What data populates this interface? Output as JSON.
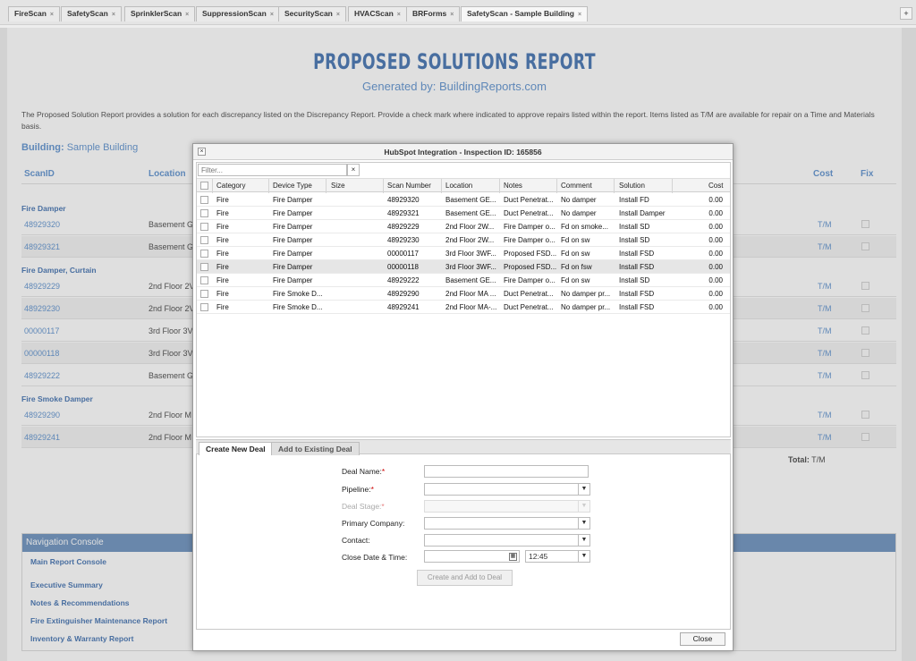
{
  "tabs": [
    {
      "label": "FireScan"
    },
    {
      "label": "SafetyScan"
    },
    {
      "label": "SprinklerScan"
    },
    {
      "label": "SuppressionScan"
    },
    {
      "label": "SecurityScan"
    },
    {
      "label": "HVACScan"
    },
    {
      "label": "BRForms"
    },
    {
      "label": "SafetyScan - Sample Building",
      "active": true
    }
  ],
  "tab_close_glyph": "×",
  "tab_add_label": "+",
  "report": {
    "title": "PROPOSED SOLUTIONS REPORT",
    "subtitle": "Generated by: BuildingReports.com",
    "intro": "The Proposed Solution Report provides a solution for each discrepancy listed on the Discrepancy Report. Provide a check mark where indicated to approve repairs listed within the report. Items listed as T/M are available for repair on a Time and Materials basis.",
    "building_label": "Building:",
    "building_name": "Sample Building",
    "columns": {
      "scan_id": "ScanID",
      "location": "Location",
      "cost": "Cost",
      "fix": "Fix"
    },
    "groups": [
      {
        "name": "Fire Damper",
        "rows": [
          {
            "scan_id": "48929320",
            "location": "Basement G",
            "cost": "T/M"
          },
          {
            "scan_id": "48929321",
            "location": "Basement G",
            "cost": "T/M"
          }
        ]
      },
      {
        "name": "Fire Damper, Curtain",
        "rows": [
          {
            "scan_id": "48929229",
            "location": "2nd Floor 2V",
            "cost": "T/M"
          },
          {
            "scan_id": "48929230",
            "location": "2nd Floor 2V",
            "cost": "T/M"
          },
          {
            "scan_id": "00000117",
            "location": "3rd Floor 3V",
            "cost": "T/M"
          },
          {
            "scan_id": "00000118",
            "location": "3rd Floor 3V",
            "cost": "T/M"
          },
          {
            "scan_id": "48929222",
            "location": "Basement G",
            "cost": "T/M"
          }
        ]
      },
      {
        "name": "Fire Smoke Damper",
        "rows": [
          {
            "scan_id": "48929290",
            "location": "2nd Floor M",
            "cost": "T/M"
          },
          {
            "scan_id": "48929241",
            "location": "2nd Floor M",
            "cost": "T/M"
          }
        ]
      }
    ],
    "total_label": "Total:",
    "total_value": "T/M"
  },
  "nav_console": {
    "title": "Navigation Console",
    "links": [
      "Main Report Console",
      "Executive Summary",
      "Notes & Recommendations",
      "Fire Extinguisher Maintenance Report",
      "Inventory & Warranty Report"
    ]
  },
  "dialog": {
    "title": "HubSpot Integration - Inspection ID: 165856",
    "close_x": "×",
    "filter_placeholder": "Filter...",
    "filter_clear": "×",
    "columns": [
      "Category",
      "Device Type",
      "Size",
      "Scan Number",
      "Location",
      "Notes",
      "Comment",
      "Solution",
      "Cost"
    ],
    "rows": [
      {
        "category": "Fire",
        "device_type": "Fire Damper",
        "size": "",
        "scan_number": "48929320",
        "location": "Basement GE...",
        "notes": "Duct Penetrat...",
        "comment": "No damper",
        "solution": "Install FD",
        "cost": "0.00"
      },
      {
        "category": "Fire",
        "device_type": "Fire Damper",
        "size": "",
        "scan_number": "48929321",
        "location": "Basement GE...",
        "notes": "Duct Penetrat...",
        "comment": "No damper",
        "solution": "Install Damper",
        "cost": "0.00"
      },
      {
        "category": "Fire",
        "device_type": "Fire Damper",
        "size": "",
        "scan_number": "48929229",
        "location": "2nd Floor 2W...",
        "notes": "Fire Damper o...",
        "comment": "Fd on smoke...",
        "solution": "Install SD",
        "cost": "0.00"
      },
      {
        "category": "Fire",
        "device_type": "Fire Damper",
        "size": "",
        "scan_number": "48929230",
        "location": "2nd Floor 2W...",
        "notes": "Fire Damper o...",
        "comment": "Fd on sw",
        "solution": "Install SD",
        "cost": "0.00"
      },
      {
        "category": "Fire",
        "device_type": "Fire Damper",
        "size": "",
        "scan_number": "00000117",
        "location": "3rd Floor 3WF...",
        "notes": "Proposed FSD...",
        "comment": "Fd on sw",
        "solution": "Install FSD",
        "cost": "0.00"
      },
      {
        "category": "Fire",
        "device_type": "Fire Damper",
        "size": "",
        "scan_number": "00000118",
        "location": "3rd Floor 3WF...",
        "notes": "Proposed FSD...",
        "comment": "Fd on fsw",
        "solution": "Install FSD",
        "cost": "0.00",
        "selected": true
      },
      {
        "category": "Fire",
        "device_type": "Fire Damper",
        "size": "",
        "scan_number": "48929222",
        "location": "Basement GE...",
        "notes": "Fire Damper o...",
        "comment": "Fd on sw",
        "solution": "Install SD",
        "cost": "0.00"
      },
      {
        "category": "Fire",
        "device_type": "Fire Smoke D...",
        "size": "",
        "scan_number": "48929290",
        "location": "2nd Floor MA ...",
        "notes": "Duct Penetrat...",
        "comment": "No damper pr...",
        "solution": "Install FSD",
        "cost": "0.00"
      },
      {
        "category": "Fire",
        "device_type": "Fire Smoke D...",
        "size": "",
        "scan_number": "48929241",
        "location": "2nd Floor MA-...",
        "notes": "Duct Penetrat...",
        "comment": "No damper pr...",
        "solution": "Install FSD",
        "cost": "0.00"
      }
    ],
    "deal_tabs": [
      "Create New Deal",
      "Add to Existing Deal"
    ],
    "form": {
      "deal_name_label": "Deal Name:",
      "pipeline_label": "Pipeline:",
      "deal_stage_label": "Deal Stage:",
      "primary_company_label": "Primary Company:",
      "contact_label": "Contact:",
      "close_date_label": "Close Date & Time:",
      "required_mark": "*",
      "time_value": "12:45",
      "create_button": "Create and Add to Deal"
    },
    "close_button": "Close"
  },
  "icons": {
    "dropdown": "chevron-down-icon",
    "calendar": "calendar-icon",
    "checkbox": "checkbox-icon"
  },
  "colors": {
    "accent": "#2f63a8",
    "link": "#4d86c9",
    "nav_header": "#5c85b8",
    "required": "#cc0000"
  }
}
